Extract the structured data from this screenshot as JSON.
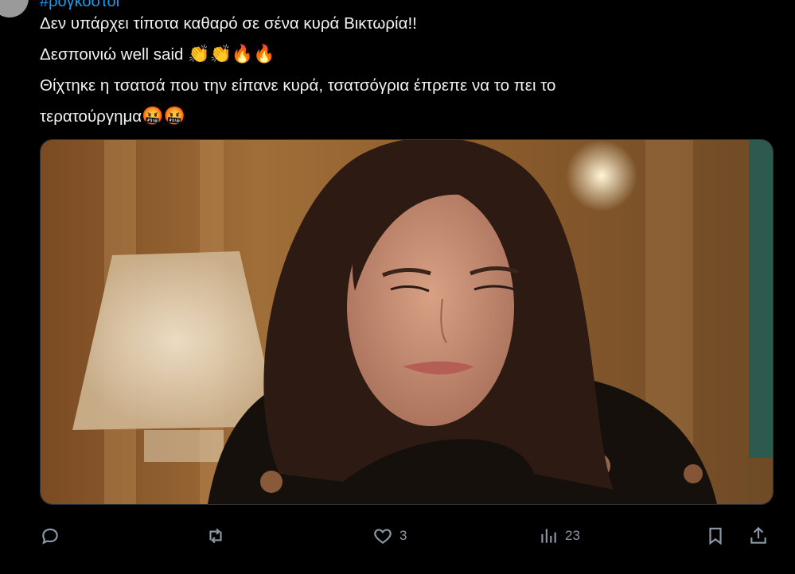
{
  "header": {
    "hashtag": "#ρογκοστοι"
  },
  "tweet": {
    "lines": [
      "Δεν υπάρχει τίποτα καθαρό σε σένα κυρά Βικτωρία!!",
      "Δεσποινιώ well said",
      "Θίχτηκε η τσατσά που την είπανε κυρά, τσατσόγρια έπρεπε να το πει το",
      "τερατούργημα"
    ],
    "line2_emojis": "👏👏🔥🔥",
    "line4_emojis": "🤬🤬"
  },
  "actions": {
    "reply_count": "",
    "retweet_count": "",
    "like_count": "3",
    "views_count": "23"
  },
  "colors": {
    "background": "#000000",
    "text": "#e7e9ea",
    "icon": "#8b98a5",
    "link": "#1d9bf0"
  }
}
